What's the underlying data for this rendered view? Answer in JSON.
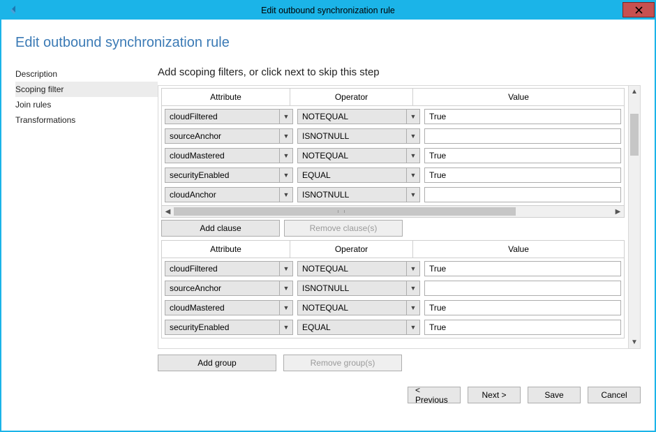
{
  "titlebar": {
    "title": "Edit outbound synchronization rule"
  },
  "page": {
    "title": "Edit outbound synchronization rule"
  },
  "sidebar": {
    "items": [
      {
        "label": "Description",
        "selected": false
      },
      {
        "label": "Scoping filter",
        "selected": true
      },
      {
        "label": "Join rules",
        "selected": false
      },
      {
        "label": "Transformations",
        "selected": false
      }
    ]
  },
  "main": {
    "step_text": "Add scoping filters, or click next to skip this step",
    "columns": {
      "attribute": "Attribute",
      "operator": "Operator",
      "value": "Value"
    },
    "groups": [
      {
        "rows": [
          {
            "attribute": "cloudFiltered",
            "operator": "NOTEQUAL",
            "value": "True"
          },
          {
            "attribute": "sourceAnchor",
            "operator": "ISNOTNULL",
            "value": ""
          },
          {
            "attribute": "cloudMastered",
            "operator": "NOTEQUAL",
            "value": "True"
          },
          {
            "attribute": "securityEnabled",
            "operator": "EQUAL",
            "value": "True"
          },
          {
            "attribute": "cloudAnchor",
            "operator": "ISNOTNULL",
            "value": ""
          }
        ],
        "has_hscroll": true
      },
      {
        "rows": [
          {
            "attribute": "cloudFiltered",
            "operator": "NOTEQUAL",
            "value": "True"
          },
          {
            "attribute": "sourceAnchor",
            "operator": "ISNOTNULL",
            "value": ""
          },
          {
            "attribute": "cloudMastered",
            "operator": "NOTEQUAL",
            "value": "True"
          },
          {
            "attribute": "securityEnabled",
            "operator": "EQUAL",
            "value": "True"
          }
        ],
        "has_hscroll": false
      }
    ],
    "buttons": {
      "add_clause": "Add clause",
      "remove_clause": "Remove clause(s)",
      "add_group": "Add group",
      "remove_group": "Remove group(s)"
    }
  },
  "footer": {
    "previous": "< Previous",
    "next": "Next >",
    "save": "Save",
    "cancel": "Cancel"
  }
}
